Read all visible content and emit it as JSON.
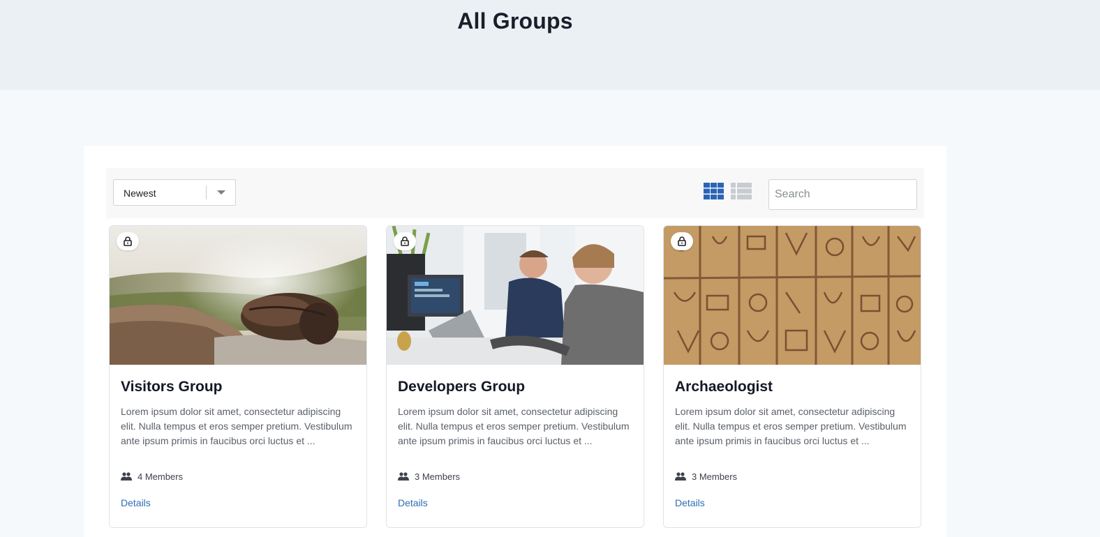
{
  "page": {
    "title": "All Groups"
  },
  "toolbar": {
    "sort_value": "Newest",
    "view_grid_icon": "grid-view-icon",
    "view_list_icon": "list-view-icon",
    "search_placeholder": "Search",
    "active_view_color": "#2a64b6",
    "inactive_view_color": "#c8ccd0"
  },
  "groups": [
    {
      "title": "Visitors Group",
      "description": "Lorem ipsum dolor sit amet, consectetur adipiscing elit. Nulla tempus et eros semper pretium. Vestibulum ante ipsum primis in faucibus orci luctus et ...",
      "members": "4 Members",
      "details_label": "Details",
      "image": "misty-mountain-landscape",
      "privacy_icon": "lock-icon"
    },
    {
      "title": "Developers Group",
      "description": "Lorem ipsum dolor sit amet, consectetur adipiscing elit. Nulla tempus et eros semper pretium. Vestibulum ante ipsum primis in faucibus orci luctus et ...",
      "members": "3 Members",
      "details_label": "Details",
      "image": "developers-at-desks",
      "privacy_icon": "lock-icon"
    },
    {
      "title": "Archaeologist",
      "description": "Lorem ipsum dolor sit amet, consectetur adipiscing elit. Nulla tempus et eros semper pretium. Vestibulum ante ipsum primis in faucibus orci luctus et ...",
      "members": "3 Members",
      "details_label": "Details",
      "image": "hieroglyphics-wall",
      "privacy_icon": "lock-icon"
    }
  ]
}
